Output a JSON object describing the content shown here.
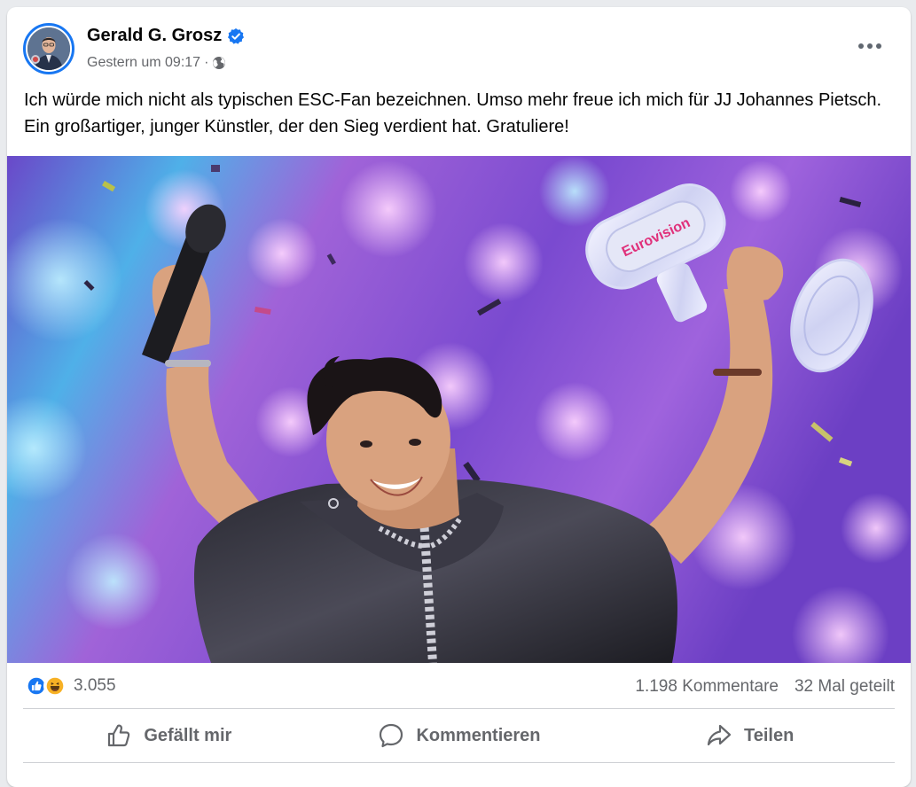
{
  "post": {
    "author": "Gerald G. Grosz",
    "timestamp": "Gestern um 09:17",
    "separator": "·",
    "text": "Ich würde mich nicht als typischen ESC-Fan bezeichnen. Umso mehr freue ich mich für JJ Johannes Pietsch. Ein großartiger, junger Künstler, der den Sieg verdient hat. Gratuliere!"
  },
  "photo": {
    "trophy_text": "Eurovision"
  },
  "stats": {
    "reaction_count": "3.055",
    "comments": "1.198 Kommentare",
    "shares": "32 Mal geteilt"
  },
  "actions": {
    "like": "Gefällt mir",
    "comment": "Kommentieren",
    "share": "Teilen"
  },
  "colors": {
    "accent": "#1877f2",
    "secondary_text": "#65676b"
  }
}
